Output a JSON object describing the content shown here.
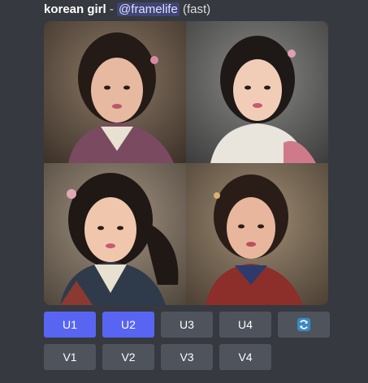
{
  "header": {
    "prompt": "korean girl",
    "separator": " - ",
    "mention": "@framelife",
    "mode": "(fast)"
  },
  "images": [
    {
      "icon": "portrait-image-1"
    },
    {
      "icon": "portrait-image-2"
    },
    {
      "icon": "portrait-image-3"
    },
    {
      "icon": "portrait-image-4"
    }
  ],
  "upscale_buttons": [
    "U1",
    "U2",
    "U3",
    "U4"
  ],
  "variation_buttons": [
    "V1",
    "V2",
    "V3",
    "V4"
  ],
  "refresh_icon": "refresh-icon",
  "colors": {
    "background": "#36393f",
    "button": "#4f545c",
    "button_primary": "#5865f2",
    "mention_bg": "#414675",
    "link": "#00aff4"
  }
}
